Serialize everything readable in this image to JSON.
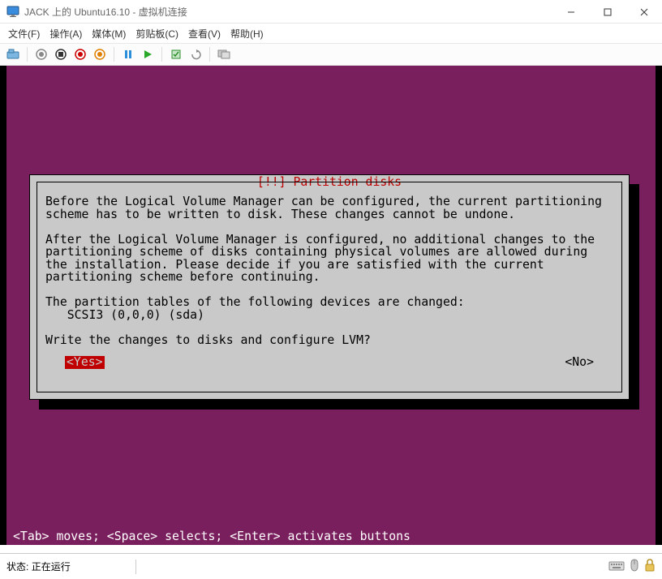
{
  "window": {
    "title": "JACK 上的 Ubuntu16.10 - 虚拟机连接"
  },
  "menu": {
    "file": "文件(F)",
    "action": "操作(A)",
    "media": "媒体(M)",
    "clipboard": "剪贴板(C)",
    "view": "查看(V)",
    "help": "帮助(H)"
  },
  "dialog": {
    "title": "[!!] Partition disks",
    "para1": "Before the Logical Volume Manager can be configured, the current partitioning scheme has to be written to disk. These changes cannot be undone.",
    "para2": "After the Logical Volume Manager is configured, no additional changes to the partitioning scheme of disks containing physical volumes are allowed during the installation. Please decide if you are satisfied with the current partitioning scheme before continuing.",
    "para3": "The partition tables of the following devices are changed:",
    "device1": "   SCSI3 (0,0,0) (sda)",
    "question": "Write the changes to disks and configure LVM?",
    "yes": "<Yes>",
    "no": "<No>"
  },
  "help_line": "<Tab> moves; <Space> selects; <Enter> activates buttons",
  "status": {
    "label": "状态:",
    "value": "正在运行"
  },
  "colors": {
    "vm_bg": "#7a1f5e",
    "dialog_bg": "#c9c9c9",
    "red": "#c00000"
  }
}
